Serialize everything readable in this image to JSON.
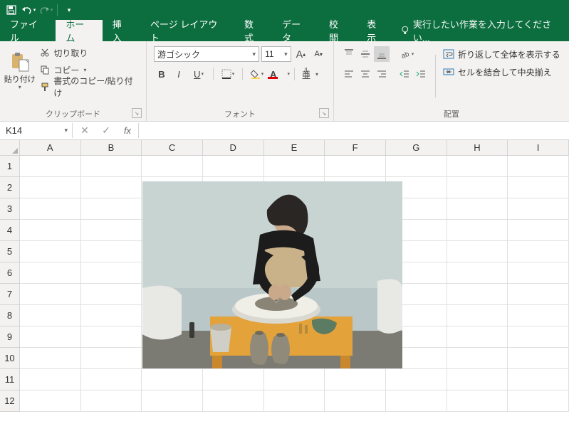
{
  "qat": {
    "save": "save-icon",
    "undo": "undo-icon",
    "redo": "redo-icon"
  },
  "tabs": {
    "file": "ファイル",
    "home": "ホーム",
    "insert": "挿入",
    "pagelayout": "ページ レイアウト",
    "formulas": "数式",
    "data": "データ",
    "review": "校閲",
    "view": "表示"
  },
  "tell_me": "実行したい作業を入力してください...",
  "clipboard": {
    "paste": "貼り付け",
    "cut": "切り取り",
    "copy": "コピー",
    "format_painter": "書式のコピー/貼り付け",
    "group": "クリップボード"
  },
  "font": {
    "name": "游ゴシック",
    "size": "11",
    "group": "フォント",
    "ruby": "ル",
    "ruby2": "ビ"
  },
  "alignment": {
    "group": "配置",
    "wrap": "折り返して全体を表示する",
    "merge": "セルを結合して中央揃え"
  },
  "namebox": "K14",
  "columns": [
    "A",
    "B",
    "C",
    "D",
    "E",
    "F",
    "G",
    "H",
    "I"
  ],
  "rows": [
    "1",
    "2",
    "3",
    "4",
    "5",
    "6",
    "7",
    "8",
    "9",
    "10",
    "11",
    "12"
  ],
  "image_alt": "pottery photo"
}
